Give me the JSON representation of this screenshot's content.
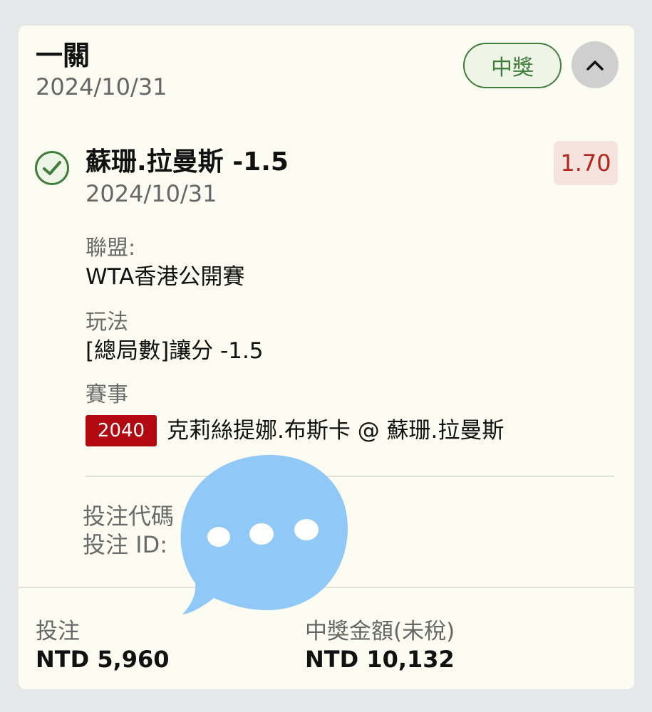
{
  "header": {
    "title": "一關",
    "date": "2024/10/31",
    "status": "中獎"
  },
  "selection": {
    "name": "蘇珊.拉曼斯 -1.5",
    "odds": "1.70",
    "date": "2024/10/31"
  },
  "details": {
    "league_label": "聯盟:",
    "league_value": "WTA香港公開賽",
    "market_label": "玩法",
    "market_value": "[總局數]讓分 -1.5",
    "event_label": "賽事",
    "event_id": "2040",
    "event_name": "克莉絲提娜.布斯卡 @ 蘇珊.拉曼斯"
  },
  "bet_meta": {
    "code_label": "投注代碼",
    "id_label": "投注 ID: "
  },
  "footer": {
    "stake_label": "投注",
    "stake_value": "NTD 5,960",
    "payout_label": "中獎金額(未稅)",
    "payout_value": "NTD 10,132"
  },
  "colors": {
    "win_green": "#3f7d3a",
    "odds_red": "#b3261e",
    "event_badge": "#b1090f",
    "card_bg": "#fdfcf2",
    "overlay_blue": "#90c8f8"
  },
  "icons": {
    "check": "check-circle-icon",
    "collapse": "chevron-up-icon",
    "overlay": "chat-bubble-icon"
  }
}
